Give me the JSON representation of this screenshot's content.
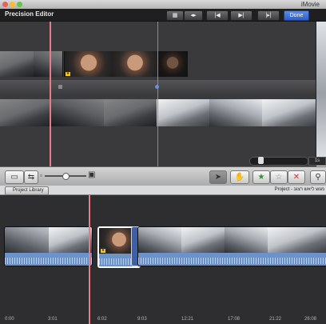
{
  "window": {
    "title": "iMovie"
  },
  "precision_editor": {
    "label": "Precision Editor",
    "done_label": "Done",
    "zoom_value": "1s"
  },
  "project": {
    "library_label": "Project Library",
    "title": "Project - מגש ליאש רצגנ"
  },
  "timeline_ticks": [
    "0:00",
    "3:01",
    "6:02",
    "9:03",
    "12:21",
    "17:08",
    "21:22",
    "26:08"
  ],
  "colors": {
    "done": "#2c5fc9",
    "playhead": "#e87c84",
    "audio": "#6b93c9"
  }
}
